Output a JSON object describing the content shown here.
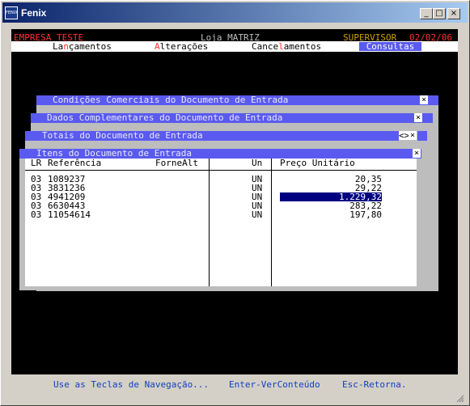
{
  "window": {
    "title": "Fenix",
    "icon_label": "FENIX",
    "minimize_glyph": "_",
    "maximize_glyph": "□",
    "close_glyph": "×"
  },
  "header": {
    "company": "EMPRESA TESTE",
    "store": "Loja MATRIZ",
    "role": "SUPERVISOR",
    "date": "02/02/06"
  },
  "menu": {
    "items": [
      {
        "pre": "La",
        "hot": "n",
        "post": "çamentos"
      },
      {
        "pre": "",
        "hot": "A",
        "post": "lterações"
      },
      {
        "pre": "Cance",
        "hot": "l",
        "post": "amentos"
      }
    ],
    "active": "Consultas"
  },
  "windows": [
    {
      "title": "Condições Comerciais do Documento de Entrada"
    },
    {
      "title": "Dados Complementares do Documento de Entrada"
    },
    {
      "title": "Totais do Documento de Entrada",
      "nav_glyph": "<>"
    },
    {
      "title": "Itens do Documento de Entrada"
    }
  ],
  "close_glyph": "×",
  "table": {
    "columns": [
      "LR",
      "Referência",
      "ForneAlt",
      "Un",
      "Preço Unitário"
    ],
    "rows": [
      {
        "lr": "03",
        "ref": "1089237",
        "forne": "",
        "un": "UN",
        "preco": "20,35"
      },
      {
        "lr": "03",
        "ref": "3831236",
        "forne": "",
        "un": "UN",
        "preco": "29,22"
      },
      {
        "lr": "03",
        "ref": "4941209",
        "forne": "",
        "un": "UN",
        "preco": "1.229,32",
        "selected": true
      },
      {
        "lr": "03",
        "ref": "6630443",
        "forne": "",
        "un": "UN",
        "preco": "283,22"
      },
      {
        "lr": "03",
        "ref": "11054614",
        "forne": "",
        "un": "UN",
        "preco": "197,80"
      }
    ]
  },
  "footer": {
    "hint_nav": "Use as Teclas de Navegação...",
    "hint_enter": "Enter-VerConteúdo",
    "hint_esc": "Esc-Retorna."
  }
}
